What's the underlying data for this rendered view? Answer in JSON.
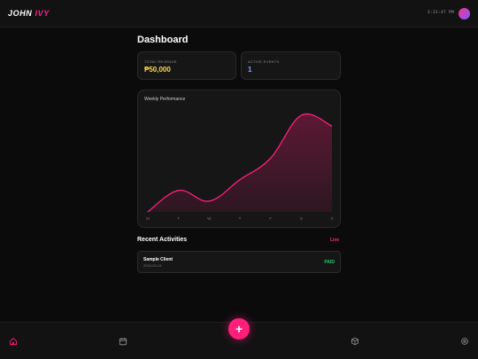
{
  "header": {
    "brand_first": "JOHN",
    "brand_second": "IVY",
    "time": "3:33:47 PM"
  },
  "page": {
    "title": "Dashboard"
  },
  "stats": [
    {
      "label": "TOTAL REVENUE",
      "value": "₱50,000"
    },
    {
      "label": "ACTIVE EVENTS",
      "value": "1"
    }
  ],
  "chart": {
    "title": "Weekly Performance"
  },
  "chart_data": {
    "type": "area",
    "categories": [
      "M",
      "T",
      "W",
      "T",
      "F",
      "S",
      "S"
    ],
    "values": [
      0,
      2,
      1,
      3,
      5,
      9,
      8
    ],
    "title": "Weekly Performance",
    "xlabel": "",
    "ylabel": "",
    "ylim": [
      0,
      10
    ],
    "grid": false,
    "color": "#ff1f7a"
  },
  "activities": {
    "title": "Recent Activities",
    "badge": "Live",
    "items": [
      {
        "name": "Sample Client",
        "date": "2024-03-14",
        "status": "PAID"
      }
    ]
  },
  "nav": {
    "fab_label": "+",
    "icons": [
      "home-icon",
      "calendar-icon",
      "box-icon",
      "settings-icon"
    ]
  },
  "colors": {
    "accent": "#ff1f7a",
    "revenue": "#ffd84d",
    "events": "#7ea8ff",
    "paid": "#25c76a",
    "background": "#0b0b0c"
  }
}
